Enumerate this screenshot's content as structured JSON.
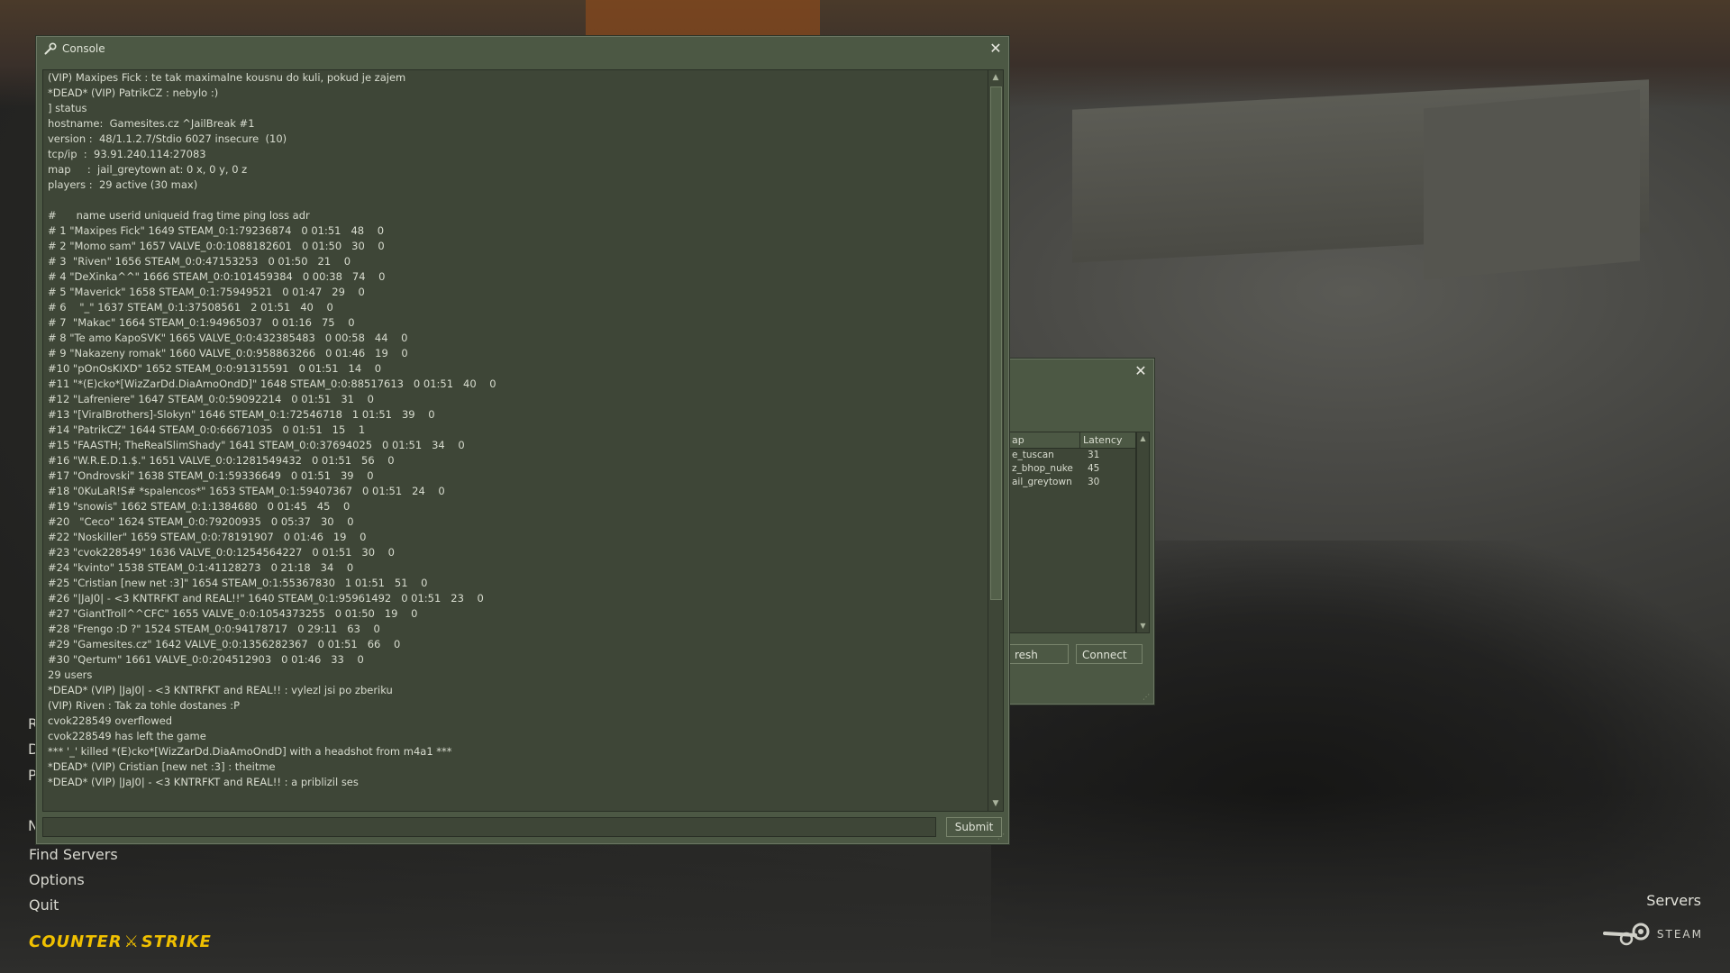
{
  "console": {
    "title": "Console",
    "lines": [
      "(VIP) Maxipes Fick : te tak maximalne kousnu do kuli, pokud je zajem",
      "*DEAD* (VIP) PatrikCZ : nebylo :)",
      "] status",
      "hostname:  Gamesites.cz ^JailBreak #1",
      "version :  48/1.1.2.7/Stdio 6027 insecure  (10)",
      "tcp/ip  :  93.91.240.114:27083",
      "map     :  jail_greytown at: 0 x, 0 y, 0 z",
      "players :  29 active (30 max)",
      "",
      "#      name userid uniqueid frag time ping loss adr",
      "# 1 \"Maxipes Fick\" 1649 STEAM_0:1:79236874   0 01:51   48    0",
      "# 2 \"Momo sam\" 1657 VALVE_0:0:1088182601   0 01:50   30    0",
      "# 3  \"Riven\" 1656 STEAM_0:0:47153253   0 01:50   21    0",
      "# 4 \"DeXinka^^\" 1666 STEAM_0:0:101459384   0 00:38   74    0",
      "# 5 \"Maverick\" 1658 STEAM_0:1:75949521   0 01:47   29    0",
      "# 6    \"_\" 1637 STEAM_0:1:37508561   2 01:51   40    0",
      "# 7  \"Makac\" 1664 STEAM_0:1:94965037   0 01:16   75    0",
      "# 8 \"Te amo KapoSVK\" 1665 VALVE_0:0:432385483   0 00:58   44    0",
      "# 9 \"Nakazeny romak\" 1660 VALVE_0:0:958863266   0 01:46   19    0",
      "#10 \"pOnOsKIXD\" 1652 STEAM_0:0:91315591   0 01:51   14    0",
      "#11 \"*(E)cko*[WizZarDd.DiaAmoOndD]\" 1648 STEAM_0:0:88517613   0 01:51   40    0",
      "#12 \"Lafreniere\" 1647 STEAM_0:0:59092214   0 01:51   31    0",
      "#13 \"[ViralBrothers]-Slokyn\" 1646 STEAM_0:1:72546718   1 01:51   39    0",
      "#14 \"PatrikCZ\" 1644 STEAM_0:0:66671035   0 01:51   15    1",
      "#15 \"FAASTH; TheRealSlimShady\" 1641 STEAM_0:0:37694025   0 01:51   34    0",
      "#16 \"W.R.E.D.1.$.\" 1651 VALVE_0:0:1281549432   0 01:51   56    0",
      "#17 \"Ondrovski\" 1638 STEAM_0:1:59336649   0 01:51   39    0",
      "#18 \"0KuLaR!S# *spalencos*\" 1653 STEAM_0:1:59407367   0 01:51   24    0",
      "#19 \"snowis\" 1662 STEAM_0:1:1384680   0 01:45   45    0",
      "#20   \"Ceco\" 1624 STEAM_0:0:79200935   0 05:37   30    0",
      "#22 \"Noskiller\" 1659 STEAM_0:0:78191907   0 01:46   19    0",
      "#23 \"cvok228549\" 1636 VALVE_0:0:1254564227   0 01:51   30    0",
      "#24 \"kvinto\" 1538 STEAM_0:1:41128273   0 21:18   34    0",
      "#25 \"Cristian [new net :3]\" 1654 STEAM_0:1:55367830   1 01:51   51    0",
      "#26 \"|JaJ0| - <3 KNTRFKT and REAL!!\" 1640 STEAM_0:1:95961492   0 01:51   23    0",
      "#27 \"GiantTroll^^CFC\" 1655 VALVE_0:0:1054373255   0 01:50   19    0",
      "#28 \"Frengo :D ?\" 1524 STEAM_0:0:94178717   0 29:11   63    0",
      "#29 \"Gamesites.cz\" 1642 VALVE_0:0:1356282367   0 01:51   66    0",
      "#30 \"Qertum\" 1661 VALVE_0:0:204512903   0 01:46   33    0",
      "29 users",
      "*DEAD* (VIP) |JaJ0| - <3 KNTRFKT and REAL!! : vylezl jsi po zberiku",
      "(VIP) Riven : Tak za tohle dostanes :P",
      "cvok228549 overflowed",
      "cvok228549 has left the game",
      "*** '_' killed *(E)cko*[WizZarDd.DiaAmoOndD] with a headshot from m4a1 ***",
      "*DEAD* (VIP) Cristian [new net :3] : theitme",
      "*DEAD* (VIP) |JaJ0| - <3 KNTRFKT and REAL!! : a priblizil ses"
    ],
    "input_value": "",
    "submit_label": "Submit",
    "close_symbol": "✕"
  },
  "server_browser": {
    "close_symbol": "✕",
    "columns": [
      "ap",
      "Latency"
    ],
    "rows": [
      {
        "map": "e_tuscan",
        "latency": "31"
      },
      {
        "map": "z_bhop_nuke",
        "latency": "45"
      },
      {
        "map": "ail_greytown",
        "latency": "30"
      }
    ],
    "refresh_label": "resh",
    "connect_label": "Connect"
  },
  "main_menu": {
    "partial_items": [
      "R",
      "D",
      "P",
      "N"
    ],
    "items": [
      "Find Servers",
      "Options",
      "Quit"
    ],
    "logo_text_left": "COUNTER",
    "logo_text_right": "STRIKE"
  },
  "bottom_right": {
    "servers_label": "Servers",
    "steam_label": "STEAM"
  },
  "colors": {
    "panel": "#4c5844",
    "panel_inner": "#3e4637",
    "text": "#d8dccf",
    "logo": "#f0c000"
  },
  "icons": {
    "console_title": "steam-icon",
    "close": "close-icon",
    "scroll_up": "arrow-up-icon",
    "scroll_down": "arrow-down-icon",
    "resize": "resize-grip-icon"
  }
}
